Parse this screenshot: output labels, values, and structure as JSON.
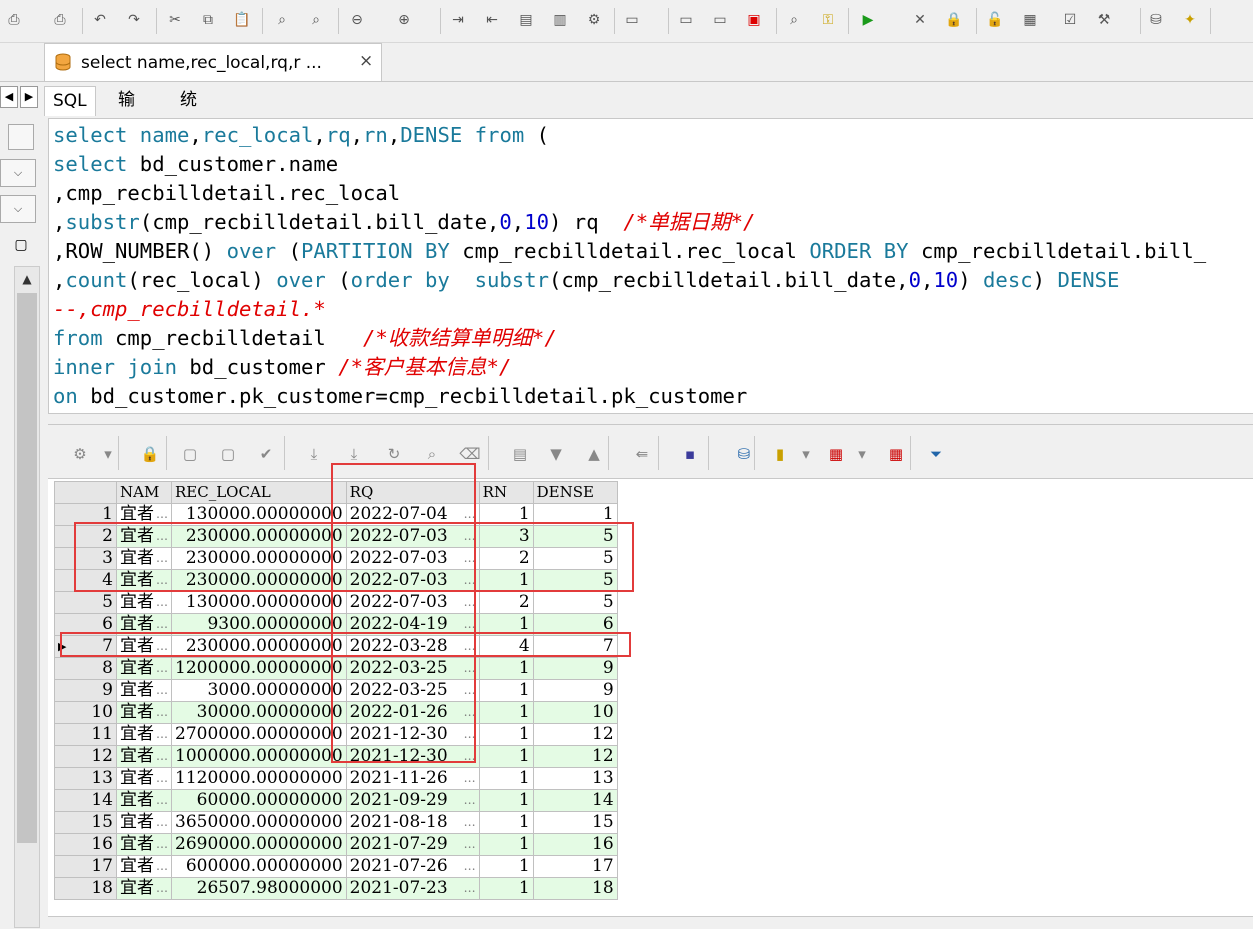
{
  "toolbar": {
    "icons": [
      "print-icon",
      "printer-setup-icon",
      "undo-icon",
      "redo-icon",
      "cut-icon",
      "copy-icon",
      "paste-icon",
      "find-icon",
      "find-next-icon",
      "back-icon",
      "forward-icon",
      "indent-icon",
      "outdent-icon",
      "comment-icon",
      "uncomment-icon",
      "connection-icon",
      "window1-icon",
      "window2-icon",
      "window3-icon",
      "oracle-icon",
      "explain-icon",
      "key-icon",
      "run-icon",
      "stop-icon",
      "lock-icon",
      "unlock-icon",
      "session-icon",
      "task-icon",
      "tools-icon",
      "db-icon",
      "logo-icon"
    ]
  },
  "tab": {
    "title": "select name,rec_local,rq,r ...",
    "close": "×"
  },
  "subtabs": [
    "SQL",
    "输出",
    "统计表"
  ],
  "sql_lines": [
    [
      [
        "kw",
        "select "
      ],
      [
        "kw",
        "name"
      ],
      [
        "",
        ","
      ],
      [
        "kw",
        "rec_local"
      ],
      [
        "",
        ","
      ],
      [
        "kw",
        "rq"
      ],
      [
        "",
        ","
      ],
      [
        "kw",
        "rn"
      ],
      [
        "",
        ","
      ],
      [
        "kw",
        "DENSE "
      ],
      [
        "kw",
        "from "
      ],
      [
        "",
        "("
      ]
    ],
    [
      [
        "kw",
        "select "
      ],
      [
        "",
        "bd_customer.name"
      ]
    ],
    [
      [
        "",
        ","
      ],
      [
        "",
        "cmp_recbilldetail.rec_local"
      ]
    ],
    [
      [
        "",
        ","
      ],
      [
        "kw",
        "substr"
      ],
      [
        "",
        "(cmp_recbilldetail.bill_date,"
      ],
      [
        "num",
        "0"
      ],
      [
        "",
        ","
      ],
      [
        "num",
        "10"
      ],
      [
        "",
        ") rq  "
      ],
      [
        "cm",
        "/*单据日期*/"
      ]
    ],
    [
      [
        "",
        ","
      ],
      [
        "",
        "ROW_NUMBER() "
      ],
      [
        "kw",
        "over "
      ],
      [
        "",
        "("
      ],
      [
        "kw",
        "PARTITION BY "
      ],
      [
        "",
        "cmp_recbilldetail.rec_local "
      ],
      [
        "kw",
        "ORDER BY "
      ],
      [
        "",
        "cmp_recbilldetail.bill_"
      ]
    ],
    [
      [
        "",
        ","
      ],
      [
        "kw",
        "count"
      ],
      [
        "",
        "(rec_local) "
      ],
      [
        "kw",
        "over "
      ],
      [
        "",
        "("
      ],
      [
        "kw",
        "order by  "
      ],
      [
        "kw",
        "substr"
      ],
      [
        "",
        "(cmp_recbilldetail.bill_date,"
      ],
      [
        "num",
        "0"
      ],
      [
        "",
        ","
      ],
      [
        "num",
        "10"
      ],
      [
        "",
        ") "
      ],
      [
        "kw",
        "desc"
      ],
      [
        "",
        ") "
      ],
      [
        "kw",
        "DENSE"
      ]
    ],
    [
      [
        "cm",
        "--,cmp_recbilldetail.*"
      ]
    ],
    [
      [
        "kw",
        "from "
      ],
      [
        "",
        "cmp_recbilldetail   "
      ],
      [
        "cm",
        "/*收款结算单明细*/"
      ]
    ],
    [
      [
        "kw",
        "inner join "
      ],
      [
        "",
        "bd_customer "
      ],
      [
        "cm",
        "/*客户基本信息*/"
      ]
    ],
    [
      [
        "kw",
        "on "
      ],
      [
        "",
        "bd_customer.pk_customer=cmp_recbilldetail.pk_customer"
      ]
    ]
  ],
  "grid": {
    "columns": [
      "NAM",
      "REC_LOCAL",
      "RQ",
      "RN",
      "DENSE"
    ],
    "ellipsis": "…",
    "rows": [
      {
        "n": "1",
        "name": "宜者",
        "rec": "130000.00000000",
        "rq": "2022-07-04",
        "rn": "1",
        "dense": "1"
      },
      {
        "n": "2",
        "name": "宜者",
        "rec": "230000.00000000",
        "rq": "2022-07-03",
        "rn": "3",
        "dense": "5"
      },
      {
        "n": "3",
        "name": "宜者",
        "rec": "230000.00000000",
        "rq": "2022-07-03",
        "rn": "2",
        "dense": "5"
      },
      {
        "n": "4",
        "name": "宜者",
        "rec": "230000.00000000",
        "rq": "2022-07-03",
        "rn": "1",
        "dense": "5"
      },
      {
        "n": "5",
        "name": "宜者",
        "rec": "130000.00000000",
        "rq": "2022-07-03",
        "rn": "2",
        "dense": "5"
      },
      {
        "n": "6",
        "name": "宜者",
        "rec": "9300.00000000",
        "rq": "2022-04-19",
        "rn": "1",
        "dense": "6"
      },
      {
        "n": "7",
        "name": "宜者",
        "rec": "230000.00000000",
        "rq": "2022-03-28",
        "rn": "4",
        "dense": "7"
      },
      {
        "n": "8",
        "name": "宜者",
        "rec": "1200000.00000000",
        "rq": "2022-03-25",
        "rn": "1",
        "dense": "9"
      },
      {
        "n": "9",
        "name": "宜者",
        "rec": "3000.00000000",
        "rq": "2022-03-25",
        "rn": "1",
        "dense": "9"
      },
      {
        "n": "10",
        "name": "宜者",
        "rec": "30000.00000000",
        "rq": "2022-01-26",
        "rn": "1",
        "dense": "10"
      },
      {
        "n": "11",
        "name": "宜者",
        "rec": "2700000.00000000",
        "rq": "2021-12-30",
        "rn": "1",
        "dense": "12"
      },
      {
        "n": "12",
        "name": "宜者",
        "rec": "1000000.00000000",
        "rq": "2021-12-30",
        "rn": "1",
        "dense": "12"
      },
      {
        "n": "13",
        "name": "宜者",
        "rec": "1120000.00000000",
        "rq": "2021-11-26",
        "rn": "1",
        "dense": "13"
      },
      {
        "n": "14",
        "name": "宜者",
        "rec": "60000.00000000",
        "rq": "2021-09-29",
        "rn": "1",
        "dense": "14"
      },
      {
        "n": "15",
        "name": "宜者",
        "rec": "3650000.00000000",
        "rq": "2021-08-18",
        "rn": "1",
        "dense": "15"
      },
      {
        "n": "16",
        "name": "宜者",
        "rec": "2690000.00000000",
        "rq": "2021-07-29",
        "rn": "1",
        "dense": "16"
      },
      {
        "n": "17",
        "name": "宜者",
        "rec": "600000.00000000",
        "rq": "2021-07-26",
        "rn": "1",
        "dense": "17"
      },
      {
        "n": "18",
        "name": "宜者",
        "rec": "26507.98000000",
        "rq": "2021-07-23",
        "rn": "1",
        "dense": "18"
      }
    ],
    "current_row": "7"
  },
  "colors": {
    "keyword": "#1a7a9b",
    "number": "#0000cc",
    "comment": "#e00000",
    "row_alt": "#e4fbe4",
    "highlight": "#e23b3b"
  }
}
